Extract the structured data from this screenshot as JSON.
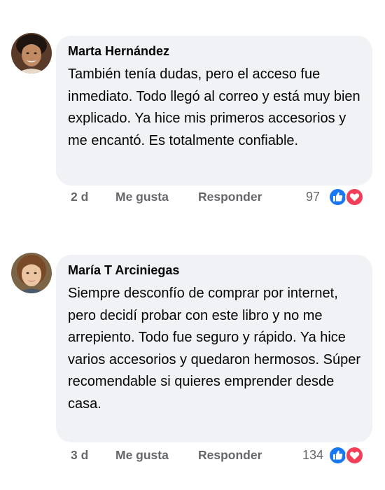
{
  "comments": [
    {
      "author": "Marta Hernández",
      "text": "También tenía dudas, pero el acceso fue inmediato. Todo llegó al correo y está muy bien explicado. Ya hice mis primeros accesorios y me encantó. Es totalmente confiable.",
      "time": "2 d",
      "like_label": "Me gusta",
      "reply_label": "Responder",
      "reaction_count": "97",
      "reactions": [
        "like-icon",
        "love-icon"
      ]
    },
    {
      "author": "María T Arciniegas",
      "text": "Siempre desconfío de comprar por internet, pero decidí probar con este libro y no me arrepiento. Todo fue seguro y rápido. Ya hice varios accesorios y quedaron hermosos. Súper recomendable si quieres emprender desde casa.",
      "time": "3 d",
      "like_label": "Me gusta",
      "reply_label": "Responder",
      "reaction_count": "134",
      "reactions": [
        "like-icon",
        "love-icon"
      ]
    }
  ],
  "colors": {
    "bubble": "#f0f2f5",
    "like_blue": "#1877f2",
    "love_red": "#f33e58",
    "meta_gray": "#65676b"
  }
}
